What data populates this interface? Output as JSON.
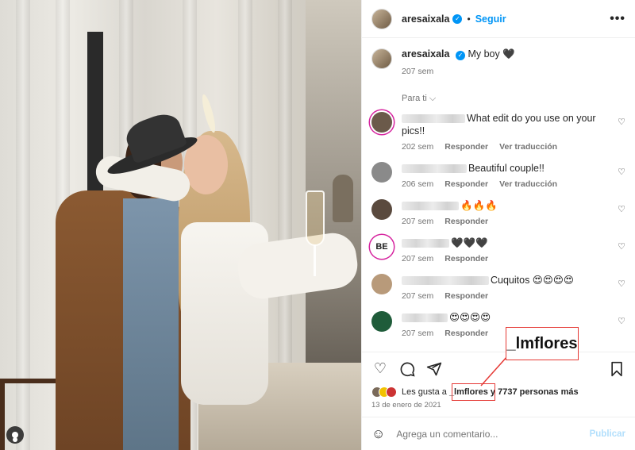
{
  "post": {
    "username": "aresaixala",
    "dot": "•",
    "follow_label": "Seguir",
    "more_label": "•••"
  },
  "caption": {
    "username": "aresaixala",
    "text": "My boy 🖤",
    "time": "207 sem"
  },
  "sort_label": "Para ti ⌵",
  "comments": [
    {
      "text": "What edit do you use on your pics!!",
      "time": "202 sem",
      "reply": "Responder",
      "translate": "Ver traducción",
      "avatar_color": "#6b5a4a",
      "ring": "#d6249f"
    },
    {
      "text": "Beautiful couple!!",
      "time": "206 sem",
      "reply": "Responder",
      "translate": "Ver traducción",
      "avatar_color": "#8a8a8a",
      "ring": ""
    },
    {
      "text": "🔥🔥🔥",
      "time": "207 sem",
      "reply": "Responder",
      "translate": "",
      "avatar_color": "#5a4a3e",
      "ring": ""
    },
    {
      "text": "🖤🖤🖤",
      "time": "207 sem",
      "reply": "Responder",
      "translate": "",
      "avatar_color": "#ffffff",
      "ring": "#d6249f",
      "avatar_text": "BE"
    },
    {
      "text": "Cuquitos 😍😍😍😍",
      "time": "207 sem",
      "reply": "Responder",
      "translate": "",
      "avatar_color": "#b89a7a",
      "ring": ""
    },
    {
      "text": "😍😍😍😍",
      "time": "207 sem",
      "reply": "Responder",
      "translate": "",
      "avatar_color": "#1f5c3a",
      "ring": ""
    }
  ],
  "likes": {
    "prefix": "Les gusta a ",
    "user": "_lmflores",
    "suffix": " y 7737 personas más"
  },
  "date": "13 de enero de 2021",
  "add_comment": {
    "placeholder": "Agrega un comentario...",
    "publish": "Publicar"
  },
  "annotation": {
    "label": "_lmflores",
    "color": "#e53935"
  }
}
